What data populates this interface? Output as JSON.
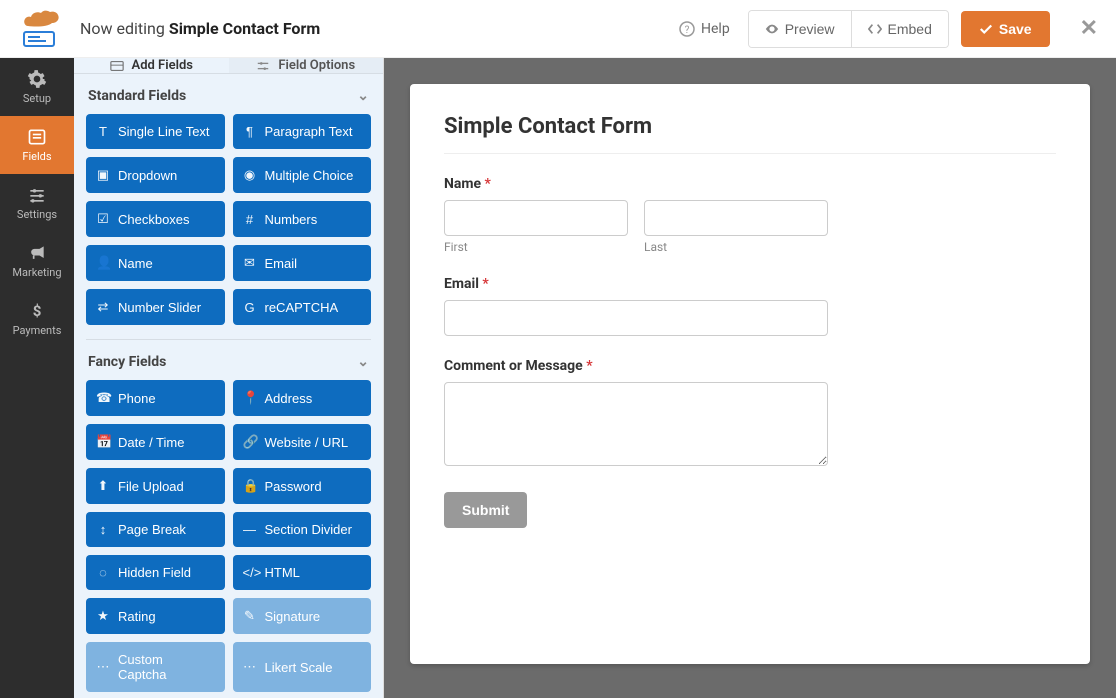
{
  "header": {
    "editing_prefix": "Now editing ",
    "form_name": "Simple Contact Form",
    "help": "Help",
    "preview": "Preview",
    "embed": "Embed",
    "save": "Save"
  },
  "sidenav": {
    "setup": "Setup",
    "fields": "Fields",
    "settings": "Settings",
    "marketing": "Marketing",
    "payments": "Payments"
  },
  "panel": {
    "tabs": {
      "add": "Add Fields",
      "options": "Field Options"
    },
    "standard_header": "Standard Fields",
    "standard": [
      {
        "label": "Single Line Text",
        "icon": "T"
      },
      {
        "label": "Paragraph Text",
        "icon": "¶"
      },
      {
        "label": "Dropdown",
        "icon": "▣"
      },
      {
        "label": "Multiple Choice",
        "icon": "◉"
      },
      {
        "label": "Checkboxes",
        "icon": "☑"
      },
      {
        "label": "Numbers",
        "icon": "#"
      },
      {
        "label": "Name",
        "icon": "👤"
      },
      {
        "label": "Email",
        "icon": "✉"
      },
      {
        "label": "Number Slider",
        "icon": "⇄"
      },
      {
        "label": "reCAPTCHA",
        "icon": "G"
      }
    ],
    "fancy_header": "Fancy Fields",
    "fancy": [
      {
        "label": "Phone",
        "icon": "☎",
        "light": false
      },
      {
        "label": "Address",
        "icon": "📍",
        "light": false
      },
      {
        "label": "Date / Time",
        "icon": "📅",
        "light": false
      },
      {
        "label": "Website / URL",
        "icon": "🔗",
        "light": false
      },
      {
        "label": "File Upload",
        "icon": "⬆",
        "light": false
      },
      {
        "label": "Password",
        "icon": "🔒",
        "light": false
      },
      {
        "label": "Page Break",
        "icon": "↕",
        "light": false
      },
      {
        "label": "Section Divider",
        "icon": "—",
        "light": false
      },
      {
        "label": "Hidden Field",
        "icon": "◌",
        "light": false
      },
      {
        "label": "HTML",
        "icon": "</>",
        "light": false
      },
      {
        "label": "Rating",
        "icon": "★",
        "light": false
      },
      {
        "label": "Signature",
        "icon": "✎",
        "light": true
      },
      {
        "label": "Custom Captcha",
        "icon": "⋯",
        "light": true
      },
      {
        "label": "Likert Scale",
        "icon": "⋯",
        "light": true
      }
    ]
  },
  "canvas": {
    "title": "Simple Contact Form",
    "name_label": "Name",
    "first_sub": "First",
    "last_sub": "Last",
    "email_label": "Email",
    "comment_label": "Comment or Message",
    "submit": "Submit"
  }
}
